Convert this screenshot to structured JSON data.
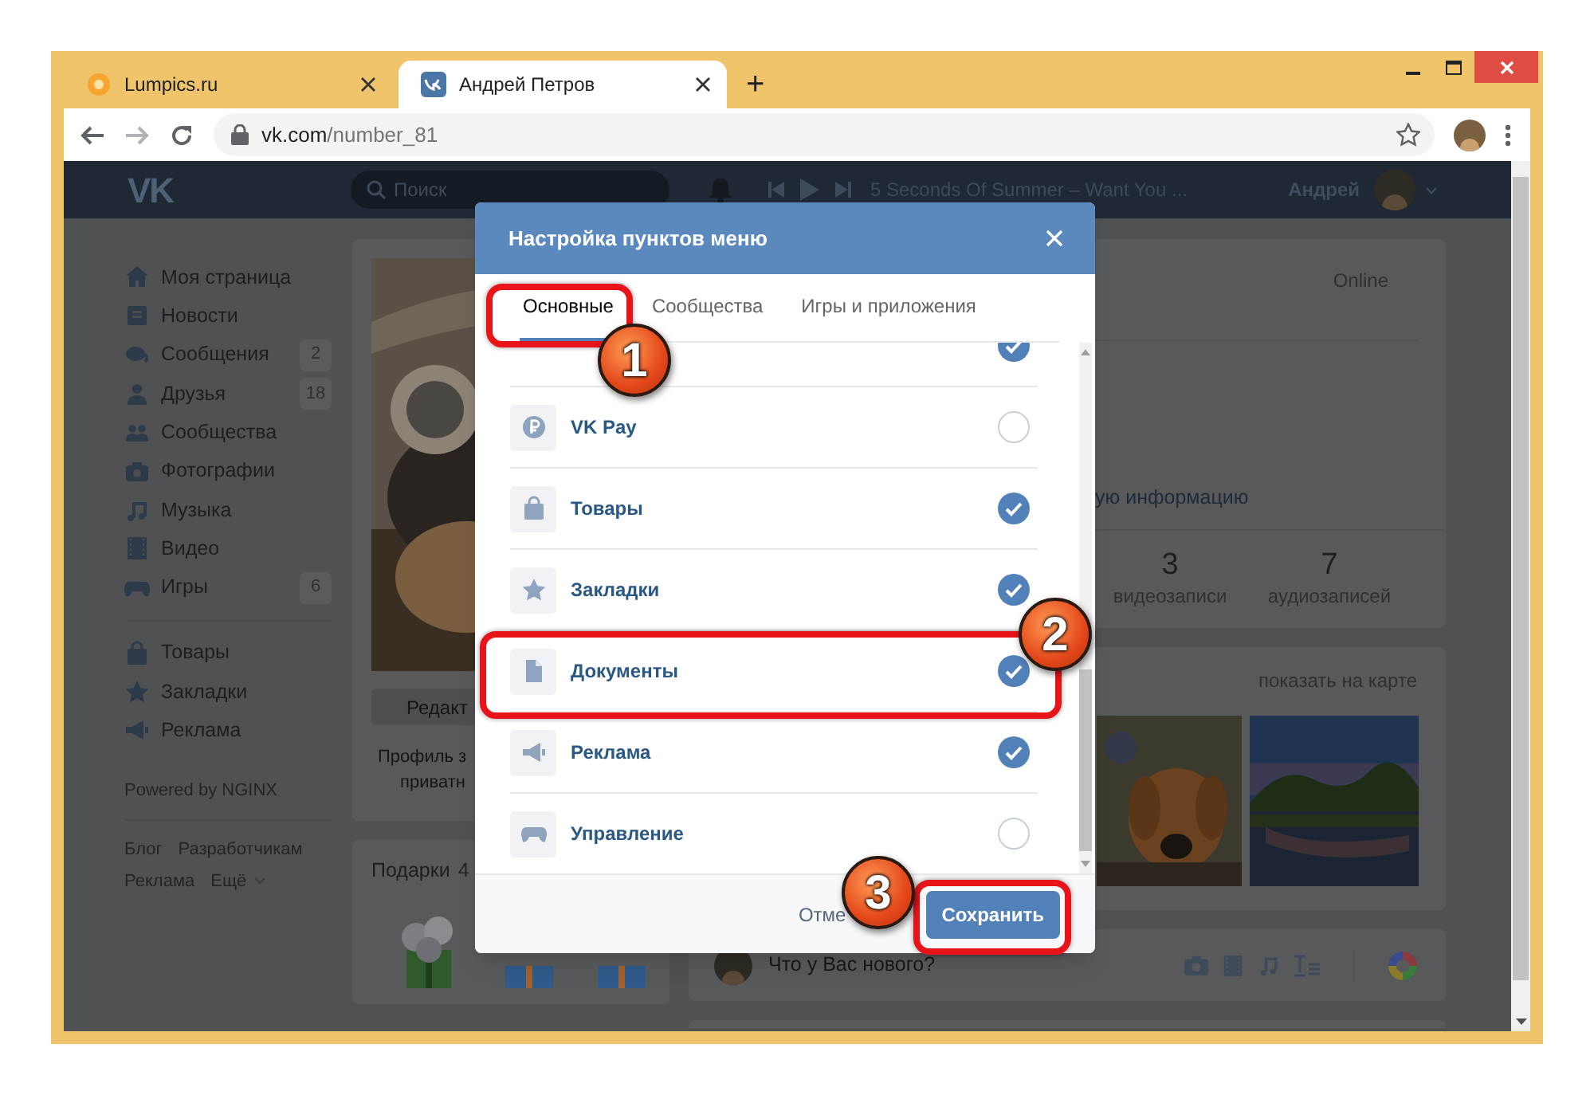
{
  "browser": {
    "tabs": [
      {
        "title": "Lumpics.ru",
        "selected": false
      },
      {
        "title": "Андрей Петров",
        "selected": true
      }
    ],
    "new_tab": "+",
    "url": {
      "host": "vk.com",
      "path": "/number_81"
    }
  },
  "header": {
    "logo": "VK",
    "search": {
      "placeholder": "Поиск"
    },
    "track": "5 Seconds Of Summer – Want You ...",
    "user": "Андрей"
  },
  "sidebar": {
    "items": [
      {
        "label": "Моя страница"
      },
      {
        "label": "Новости"
      },
      {
        "label": "Сообщения",
        "badge": "2"
      },
      {
        "label": "Друзья",
        "badge": "18"
      },
      {
        "label": "Сообщества"
      },
      {
        "label": "Фотографии"
      },
      {
        "label": "Музыка"
      },
      {
        "label": "Видео"
      },
      {
        "label": "Игры",
        "badge": "6"
      }
    ],
    "more_items": [
      {
        "label": "Товары"
      },
      {
        "label": "Закладки"
      },
      {
        "label": "Реклама"
      }
    ],
    "powered_by": "Powered by NGINX",
    "footer_links": [
      "Блог",
      "Разработчикам",
      "Реклама",
      "Ещё"
    ]
  },
  "profile": {
    "edit_button": "Редакт",
    "privacy_note": [
      "Профиль з",
      "приватн"
    ]
  },
  "gifts": {
    "title": "Подарки",
    "count": "4"
  },
  "info": {
    "status": "Online",
    "more_link": "ую информацию",
    "counters": [
      {
        "value": "3",
        "label": "видеозаписи"
      },
      {
        "value": "7",
        "label": "аудиозаписей"
      }
    ]
  },
  "photos": {
    "map_link": "показать на карте"
  },
  "post": {
    "placeholder": "Что у Вас нового?"
  },
  "modal": {
    "title": "Настройка пунктов меню",
    "tabs": [
      {
        "label": "Основные",
        "selected": true
      },
      {
        "label": "Сообщества",
        "selected": false
      },
      {
        "label": "Игры и приложения",
        "selected": false
      }
    ],
    "rows": [
      {
        "checked": true
      },
      {
        "label": "VK Pay",
        "checked": false
      },
      {
        "label": "Товары",
        "checked": true
      },
      {
        "label": "Закладки",
        "checked": true
      },
      {
        "label": "Документы",
        "checked": true
      },
      {
        "label": "Реклама",
        "checked": true
      },
      {
        "label": "Управление",
        "checked": false
      }
    ],
    "cancel": "Отме",
    "save": "Сохранить"
  },
  "annotations": [
    {
      "number": "1"
    },
    {
      "number": "2"
    },
    {
      "number": "3"
    }
  ]
}
